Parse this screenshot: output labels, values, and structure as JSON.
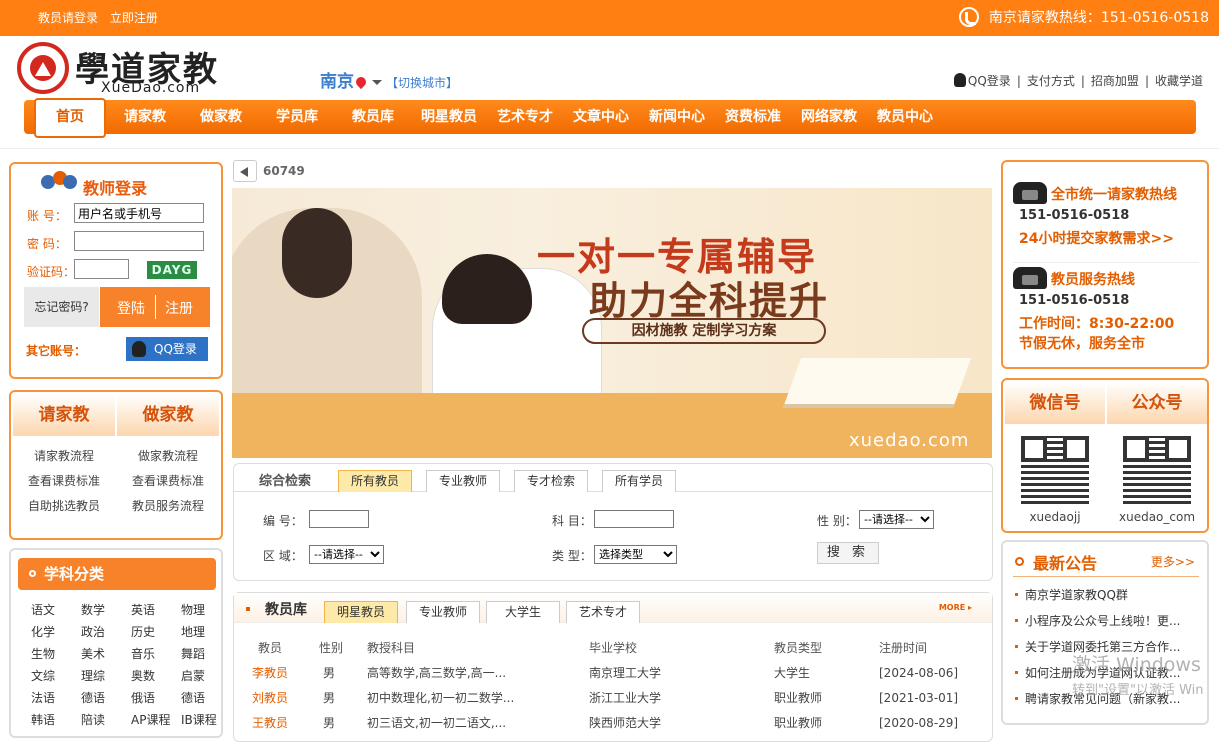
{
  "topbar": {
    "login_link": "教员请登录",
    "register_link": "立即注册",
    "hotline": "南京请家教热线：151-0516-0518"
  },
  "logo": {
    "cn": "學道家教",
    "en": "XueDao.com"
  },
  "city": {
    "name": "南京",
    "switch": "【切换城市】"
  },
  "toplinks": {
    "qq_login": "QQ登录",
    "payment": "支付方式",
    "franchise": "招商加盟",
    "bookmark": "收藏学道"
  },
  "nav": [
    "首页",
    "请家教",
    "做家教",
    "学员库",
    "教员库",
    "明星教员",
    "艺术专才",
    "文章中心",
    "新闻中心",
    "资费标准",
    "网络家教",
    "教员中心"
  ],
  "notice": {
    "count": "60749"
  },
  "login": {
    "title": "教师登录",
    "account_label": "账 号：",
    "account_value": "用户名或手机号",
    "password_label": "密 码：",
    "captcha_label": "验证码：",
    "captcha": "DAYG",
    "forgot": "忘记密码?",
    "login_btn": "登陆",
    "register_btn": "注册",
    "other": "其它账号：",
    "qq_btn": "QQ登录"
  },
  "services": {
    "hire": {
      "title": "请家教",
      "items": [
        "请家教流程",
        "查看课费标准",
        "自助挑选教员"
      ]
    },
    "tutor": {
      "title": "做家教",
      "items": [
        "做家教流程",
        "查看课费标准",
        "教员服务流程"
      ]
    }
  },
  "subjects": {
    "title": "学科分类",
    "items": [
      "语文",
      "数学",
      "英语",
      "物理",
      "化学",
      "政治",
      "历史",
      "地理",
      "生物",
      "美术",
      "音乐",
      "舞蹈",
      "文综",
      "理综",
      "奥数",
      "启蒙",
      "法语",
      "德语",
      "俄语",
      "德语",
      "韩语",
      "陪读",
      "AP课程",
      "IB课程"
    ]
  },
  "banner": {
    "line1": "一对一专属辅导",
    "line2": "助力全科提升",
    "slogan": "因材施教  定制学习方案",
    "url": "xuedao.com"
  },
  "search": {
    "label": "综合检索",
    "tabs": [
      "所有教员",
      "专业教师",
      "专才检索",
      "所有学员"
    ],
    "id_label": "编 号：",
    "subject_label": "科 目：",
    "gender_label": "性 别：",
    "gender_value": "--请选择--",
    "area_label": "区 域：",
    "area_value": "--请选择--",
    "type_label": "类 型：",
    "type_value": "选择类型",
    "button": "搜 索"
  },
  "teachers": {
    "title": "教员库",
    "tabs": [
      "明星教员",
      "专业教师",
      "大学生",
      "艺术专才"
    ],
    "more": "MORE ▸",
    "columns": [
      "教员",
      "性别",
      "教授科目",
      "毕业学校",
      "教员类型",
      "注册时间"
    ],
    "rows": [
      [
        "李教员",
        "男",
        "高等数学,高三数学,高一...",
        "南京理工大学",
        "大学生",
        "[2024-08-06]"
      ],
      [
        "刘教员",
        "男",
        "初中数理化,初一初二数学...",
        "浙江工业大学",
        "职业教师",
        "[2021-03-01]"
      ],
      [
        "王教员",
        "男",
        "初三语文,初一初二语文,...",
        "陕西师范大学",
        "职业教师",
        "[2020-08-29]"
      ]
    ]
  },
  "hotline": {
    "title1": "全市统一请家教热线",
    "tel1": "151-0516-0518",
    "link1": "24小时提交家教需求>>",
    "title2": "教员服务热线",
    "tel2": "151-0516-0518",
    "hours": "工作时间：8:30-22:00",
    "holiday": "节假无休，服务全市"
  },
  "qr": {
    "wechat_title": "微信号",
    "wechat_id": "xuedaojj",
    "mp_title": "公众号",
    "mp_id": "xuedao_com"
  },
  "announcements": {
    "title": "最新公告",
    "more": "更多>>",
    "items": [
      "南京学道家教QQ群",
      "小程序及公众号上线啦！更...",
      "关于学道网委托第三方合作...",
      "如何注册成为学道网认证教...",
      "聘请家教常见问题（新家教..."
    ]
  },
  "watermark": {
    "line1": "激活 Windows",
    "line2": "转到\"设置\"以激活 Win"
  }
}
